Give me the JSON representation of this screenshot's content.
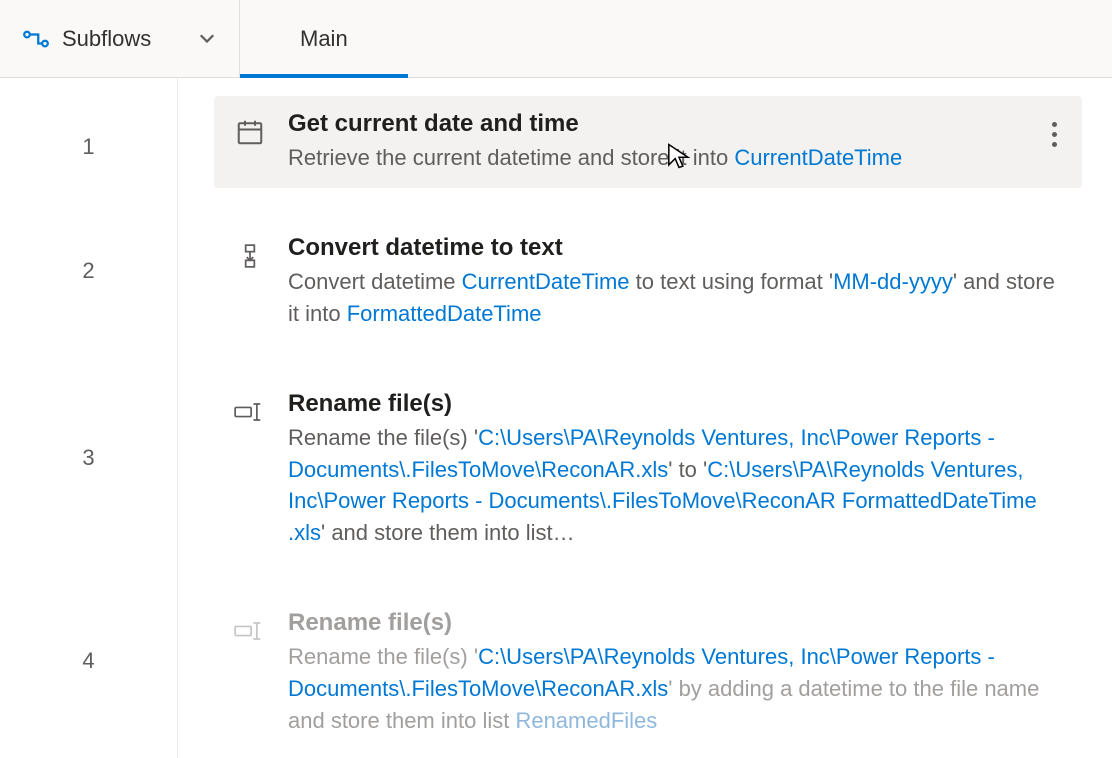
{
  "toolbar": {
    "subflows_label": "Subflows",
    "tab_main": "Main"
  },
  "line_numbers": [
    "1",
    "2",
    "3",
    "4"
  ],
  "actions": [
    {
      "title": "Get current date and time",
      "desc_prefix": "Retrieve the current datetime and store it into ",
      "var1": "CurrentDateTime"
    },
    {
      "title": "Convert datetime to text",
      "desc_prefix": "Convert datetime ",
      "var1": "CurrentDateTime",
      "desc_mid1": " to text using format '",
      "literal1": "MM-dd-yyyy",
      "desc_mid2": "' and store it into ",
      "var2": "FormattedDateTime"
    },
    {
      "title": "Rename file(s)",
      "desc_prefix": "Rename the file(s) '",
      "path1": "C:\\Users\\PA\\Reynolds Ventures, Inc\\Power Reports - Documents\\.FilesToMove\\ReconAR.xls",
      "desc_mid1": "' to '",
      "path2": "C:\\Users\\PA\\Reynolds Ventures, Inc\\Power Reports - Documents\\.FilesToMove\\ReconAR ",
      "var1": "FormattedDateTime",
      "literal1": ".xls",
      "desc_mid2": "' and store them into list…"
    },
    {
      "title": "Rename file(s)",
      "desc_prefix": "Rename the file(s) '",
      "path1": "C:\\Users\\PA\\Reynolds Ventures, Inc\\Power Reports - Documents\\.FilesToMove\\ReconAR.xls",
      "desc_mid1": "' by adding a datetime to the file name and store them into list ",
      "var1": "RenamedFiles"
    }
  ]
}
